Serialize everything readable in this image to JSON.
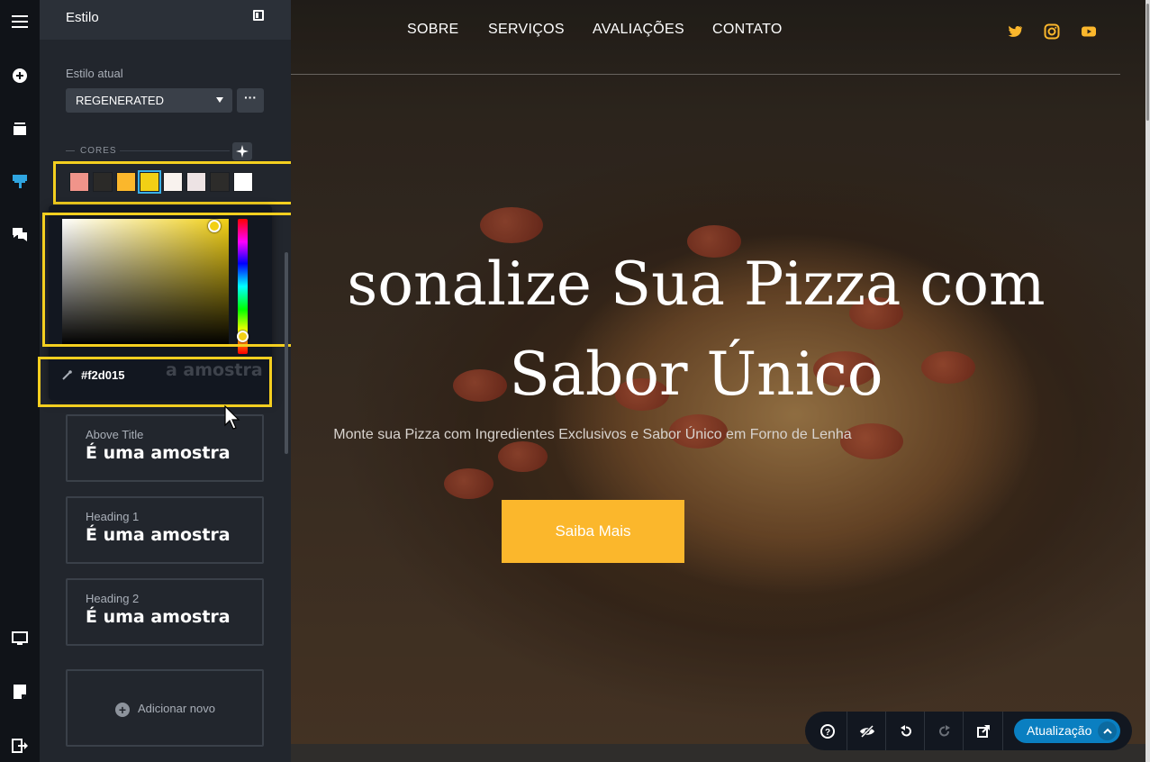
{
  "rail": {
    "items": [
      "menu",
      "add",
      "pages",
      "style",
      "comments",
      "desktop",
      "page-settings",
      "exit"
    ]
  },
  "panel": {
    "title": "Estilo",
    "current_style_label": "Estilo atual",
    "current_style_value": "REGENERATED",
    "more_label": "···",
    "colors_label": "CORES",
    "swatches": [
      "#f0948a",
      "#2b2a28",
      "#fbb72c",
      "#f2d015",
      "#f8f2ee",
      "#ede3e4",
      "#2d2c2a",
      "#ffffff"
    ],
    "selected_swatch": "#f2d015",
    "picker": {
      "hex": "#f2d015",
      "obscured_sample": "a amostra"
    },
    "typography": [
      {
        "label": "Above Title",
        "sample": "É uma amostra"
      },
      {
        "label": "Heading 1",
        "sample": "É uma amostra"
      },
      {
        "label": "Heading 2",
        "sample": "É uma amostra"
      }
    ],
    "add_new_label": "Adicionar novo"
  },
  "site": {
    "nav": [
      "SOBRE",
      "SERVIÇOS",
      "AVALIAÇÕES",
      "CONTATO"
    ],
    "social": [
      "twitter-icon",
      "instagram-icon",
      "youtube-icon"
    ],
    "accent": "#fbb72c",
    "hero_title_line1": "sonalize Sua Pizza com",
    "hero_title_line2": "Sabor Único",
    "hero_subtitle": "Monte sua Pizza com Ingredientes Exclusivos e Sabor Único em Forno de Lenha",
    "hero_button": "Saiba Mais"
  },
  "toolbar": {
    "update_label": "Atualização"
  }
}
